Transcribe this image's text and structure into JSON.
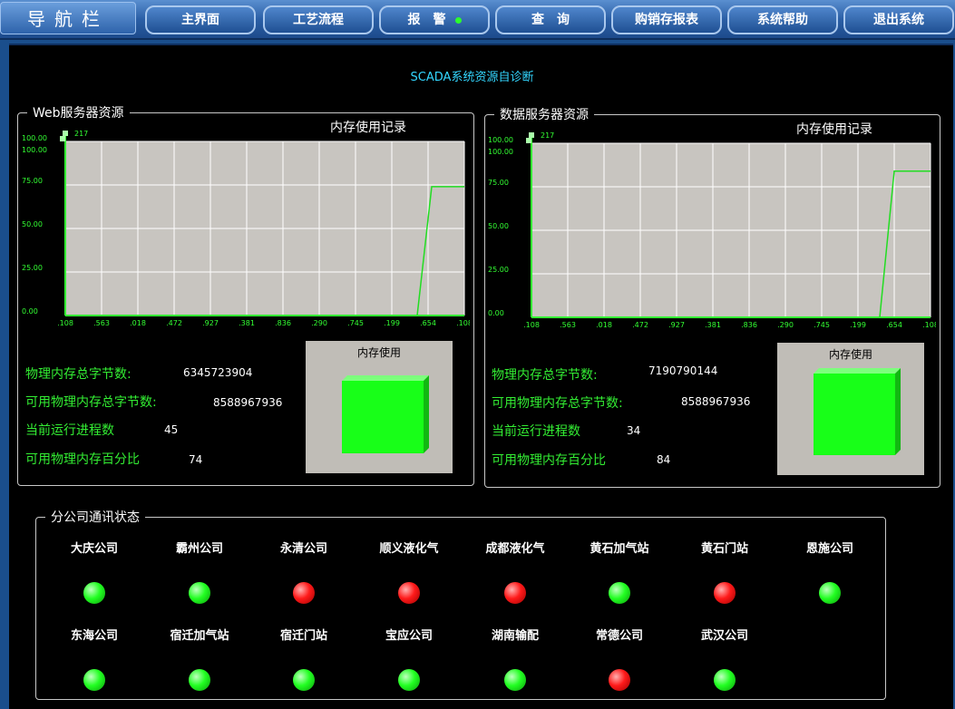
{
  "nav": {
    "title": "导航栏",
    "buttons": [
      "主界面",
      "工艺流程",
      "报　警",
      "查　询",
      "购销存报表",
      "系统帮助",
      "退出系统"
    ]
  },
  "page_title": "SCADA系统资源自诊断",
  "web_panel": {
    "legend": "Web服务器资源",
    "chart_title": "内存使用记录",
    "gauge_label": "内存使用",
    "labels": [
      "物理内存总字节数:",
      "可用物理内存总字节数:",
      "当前运行进程数",
      "可用物理内存百分比"
    ],
    "values": [
      "6345723904",
      "8588967936",
      "45",
      "74"
    ],
    "memory_usage_percent": 74
  },
  "db_panel": {
    "legend": "数据服务器资源",
    "chart_title": "内存使用记录",
    "gauge_label": "内存使用",
    "labels": [
      "物理内存总字节数:",
      "可用物理内存总字节数:",
      "当前运行进程数",
      "可用物理内存百分比"
    ],
    "values": [
      "7190790144",
      "8588967936",
      "34",
      "84"
    ],
    "memory_usage_percent": 84
  },
  "chart_data": [
    {
      "type": "line",
      "title": "内存使用记录",
      "ylim": [
        0,
        100
      ],
      "y_ticks": [
        "0.00",
        "25.00",
        "50.00",
        "75.00",
        "100.00"
      ],
      "y_top_label": "100.00",
      "x_top_label": "217",
      "x_ticks": [
        ".108",
        ".563",
        ".018",
        ".472",
        ".927",
        ".381",
        ".836",
        ".290",
        ".745",
        ".199",
        ".654",
        ".108"
      ],
      "grid": true,
      "series": [
        {
          "points": [
            [
              0,
              null
            ],
            [
              9.7,
              0
            ],
            [
              10.1,
              74
            ],
            [
              11,
              74
            ]
          ]
        }
      ]
    },
    {
      "type": "line",
      "title": "内存使用记录",
      "ylim": [
        0,
        100
      ],
      "y_ticks": [
        "0.00",
        "25.00",
        "50.00",
        "75.00",
        "100.00"
      ],
      "y_top_label": "100.00",
      "x_top_label": "217",
      "x_ticks": [
        ".108",
        ".563",
        ".018",
        ".472",
        ".927",
        ".381",
        ".836",
        ".290",
        ".745",
        ".199",
        ".654",
        ".108"
      ],
      "grid": true,
      "series": [
        {
          "points": [
            [
              0,
              null
            ],
            [
              9.6,
              0
            ],
            [
              10.0,
              84
            ],
            [
              11,
              84
            ]
          ]
        }
      ]
    }
  ],
  "branch": {
    "legend": "分公司通讯状态",
    "companies": [
      {
        "name": "大庆公司",
        "status": "on"
      },
      {
        "name": "霸州公司",
        "status": "on"
      },
      {
        "name": "永清公司",
        "status": "off"
      },
      {
        "name": "顺义液化气",
        "status": "off"
      },
      {
        "name": "成都液化气",
        "status": "off"
      },
      {
        "name": "黄石加气站",
        "status": "on"
      },
      {
        "name": "黄石门站",
        "status": "off"
      },
      {
        "name": "恩施公司",
        "status": "on"
      },
      {
        "name": "东海公司",
        "status": "on"
      },
      {
        "name": "宿迁加气站",
        "status": "on"
      },
      {
        "name": "宿迁门站",
        "status": "on"
      },
      {
        "name": "宝应公司",
        "status": "on"
      },
      {
        "name": "湖南输配",
        "status": "on"
      },
      {
        "name": "常德公司",
        "status": "off"
      },
      {
        "name": "武汉公司",
        "status": "on"
      }
    ]
  }
}
